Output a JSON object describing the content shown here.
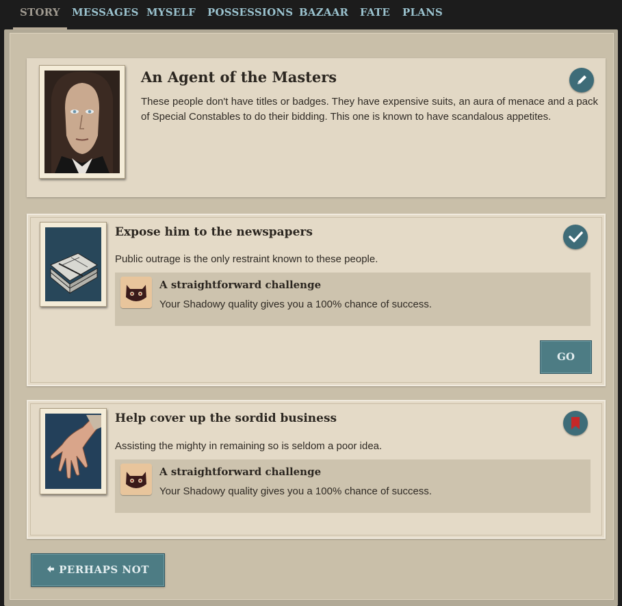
{
  "nav": {
    "tabs": [
      "STORY",
      "MESSAGES",
      "MYSELF",
      "POSSESSIONS",
      "BAZAAR",
      "FATE",
      "PLANS"
    ],
    "active": "STORY"
  },
  "storylet": {
    "title": "An Agent of the Masters",
    "description": "These people don't have titles or badges. They have expensive suits, an aura of menace and a pack of Special Constables to do their bidding. This one is known to have scandalous appetites.",
    "edit_icon": "pencil-icon"
  },
  "branches": [
    {
      "title": "Expose him to the newspapers",
      "description": "Public outrage is the only restraint known to these people.",
      "challenge_title": "A straightforward challenge",
      "challenge_text": "Your Shadowy quality gives you a 100% chance of success.",
      "status_icon": "checkmark-icon",
      "go_label": "GO"
    },
    {
      "title": "Help cover up the sordid business",
      "description": "Assisting the mighty in remaining so is seldom a poor idea.",
      "challenge_title": "A straightforward challenge",
      "challenge_text": "Your Shadowy quality gives you a 100% chance of success.",
      "status_icon": "bookmark-icon"
    }
  ],
  "back_button": {
    "label": "PERHAPS NOT"
  },
  "colors": {
    "accent": "#4d7c84",
    "circle": "#3e6c78",
    "bookmark": "#c62828"
  }
}
